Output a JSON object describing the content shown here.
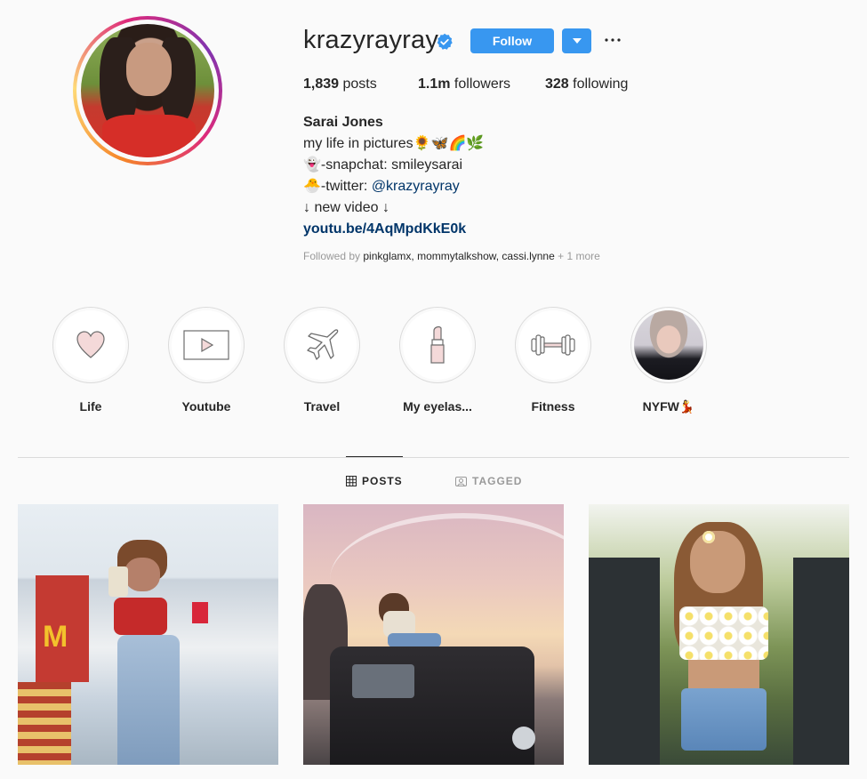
{
  "profile": {
    "username": "krazyrayray",
    "follow_label": "Follow",
    "stats": {
      "posts_count": "1,839",
      "posts_label": "posts",
      "followers_count": "1.1m",
      "followers_label": "followers",
      "following_count": "328",
      "following_label": "following"
    },
    "bio": {
      "name": "Sarai Jones",
      "line1": "my life in pictures🌻🦋🌈🌿",
      "line2": "👻-snapchat: smileysarai",
      "line3_prefix": "🐣-twitter: ",
      "line3_mention": "@krazyrayray",
      "line4": "↓ new video ↓",
      "link": "youtu.be/4AqMpdKkE0k"
    },
    "followed_by": {
      "prefix": "Followed by ",
      "names": "pinkglamx, mommytalkshow, cassi.lynne",
      "suffix": " + 1 more"
    }
  },
  "highlights": [
    {
      "label": "Life",
      "icon": "heart-icon"
    },
    {
      "label": "Youtube",
      "icon": "play-icon"
    },
    {
      "label": "Travel",
      "icon": "airplane-icon"
    },
    {
      "label": "My eyelas...",
      "icon": "lipstick-icon"
    },
    {
      "label": "Fitness",
      "icon": "dumbbell-icon"
    },
    {
      "label": "NYFW💃",
      "icon": "photo"
    }
  ],
  "tabs": {
    "posts": "POSTS",
    "tagged": "TAGGED"
  },
  "colors": {
    "accent": "#3897f0",
    "link": "#003569",
    "verified": "#3897f0"
  }
}
